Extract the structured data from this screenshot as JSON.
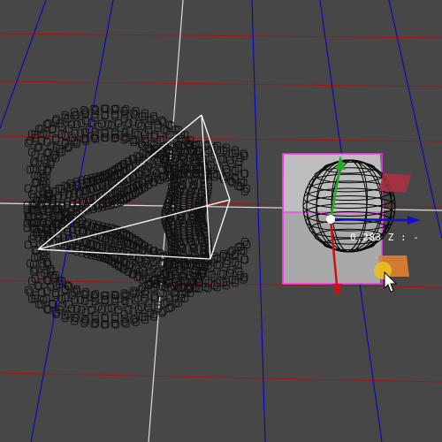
{
  "viewport": {
    "background_color": "#474747",
    "grid_color_x": "#0000cc",
    "grid_color_z": "#aa1111",
    "axis_color": "#dddddd"
  },
  "objects": {
    "torus_knot": {
      "type": "dense-wireframe-mesh",
      "color": "#111111"
    },
    "pyramid": {
      "type": "wireframe-tetrahedron",
      "color": "#ffffff"
    },
    "sphere": {
      "type": "wireframe-sphere",
      "color": "#000000",
      "selected": true
    },
    "bounding_box": {
      "color": "#ff33ff",
      "fill": "#b3b3b3"
    }
  },
  "gizmo": {
    "x_axis_color": "#1111cc",
    "y_axis_color": "#22aa22",
    "z_axis_color": "#cc1111",
    "plane_handle_red": "#b03040",
    "plane_handle_orange": "#e08030",
    "rotate_handle_color": "#e8c020"
  },
  "status": {
    "coordinate_readout": "0.283 Z : -"
  },
  "cursor": {
    "type": "arrow"
  }
}
